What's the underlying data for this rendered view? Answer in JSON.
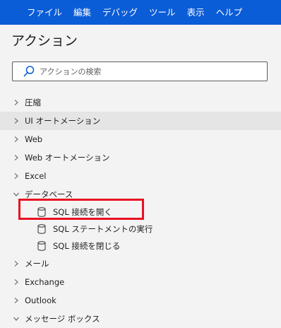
{
  "menu": [
    "ファイル",
    "編集",
    "デバッグ",
    "ツール",
    "表示",
    "ヘルプ"
  ],
  "panel": {
    "title": "アクション"
  },
  "search": {
    "placeholder": "アクションの検索"
  },
  "tree": {
    "categories": [
      {
        "label": "圧縮",
        "expanded": false
      },
      {
        "label": "UI オートメーション",
        "expanded": false
      },
      {
        "label": "Web",
        "expanded": false
      },
      {
        "label": "Web オートメーション",
        "expanded": false
      },
      {
        "label": "Excel",
        "expanded": false
      },
      {
        "label": "データベース",
        "expanded": true
      }
    ],
    "database_actions": [
      {
        "label": "SQL 接続を開く",
        "highlighted": true
      },
      {
        "label": "SQL ステートメントの実行"
      },
      {
        "label": "SQL 接続を閉じる"
      }
    ],
    "categories_after": [
      {
        "label": "メール",
        "expanded": false
      },
      {
        "label": "Exchange",
        "expanded": false
      },
      {
        "label": "Outlook",
        "expanded": false
      },
      {
        "label": "メッセージ ボックス",
        "expanded": true
      }
    ]
  },
  "colors": {
    "menubar": "#0b5cd7",
    "highlight_border": "#e81123",
    "row_hover": "#e5e5e5"
  },
  "icons": {
    "search": "search-icon",
    "chevron_right": "chevron-right-icon",
    "chevron_down": "chevron-down-icon",
    "database": "database-icon"
  }
}
